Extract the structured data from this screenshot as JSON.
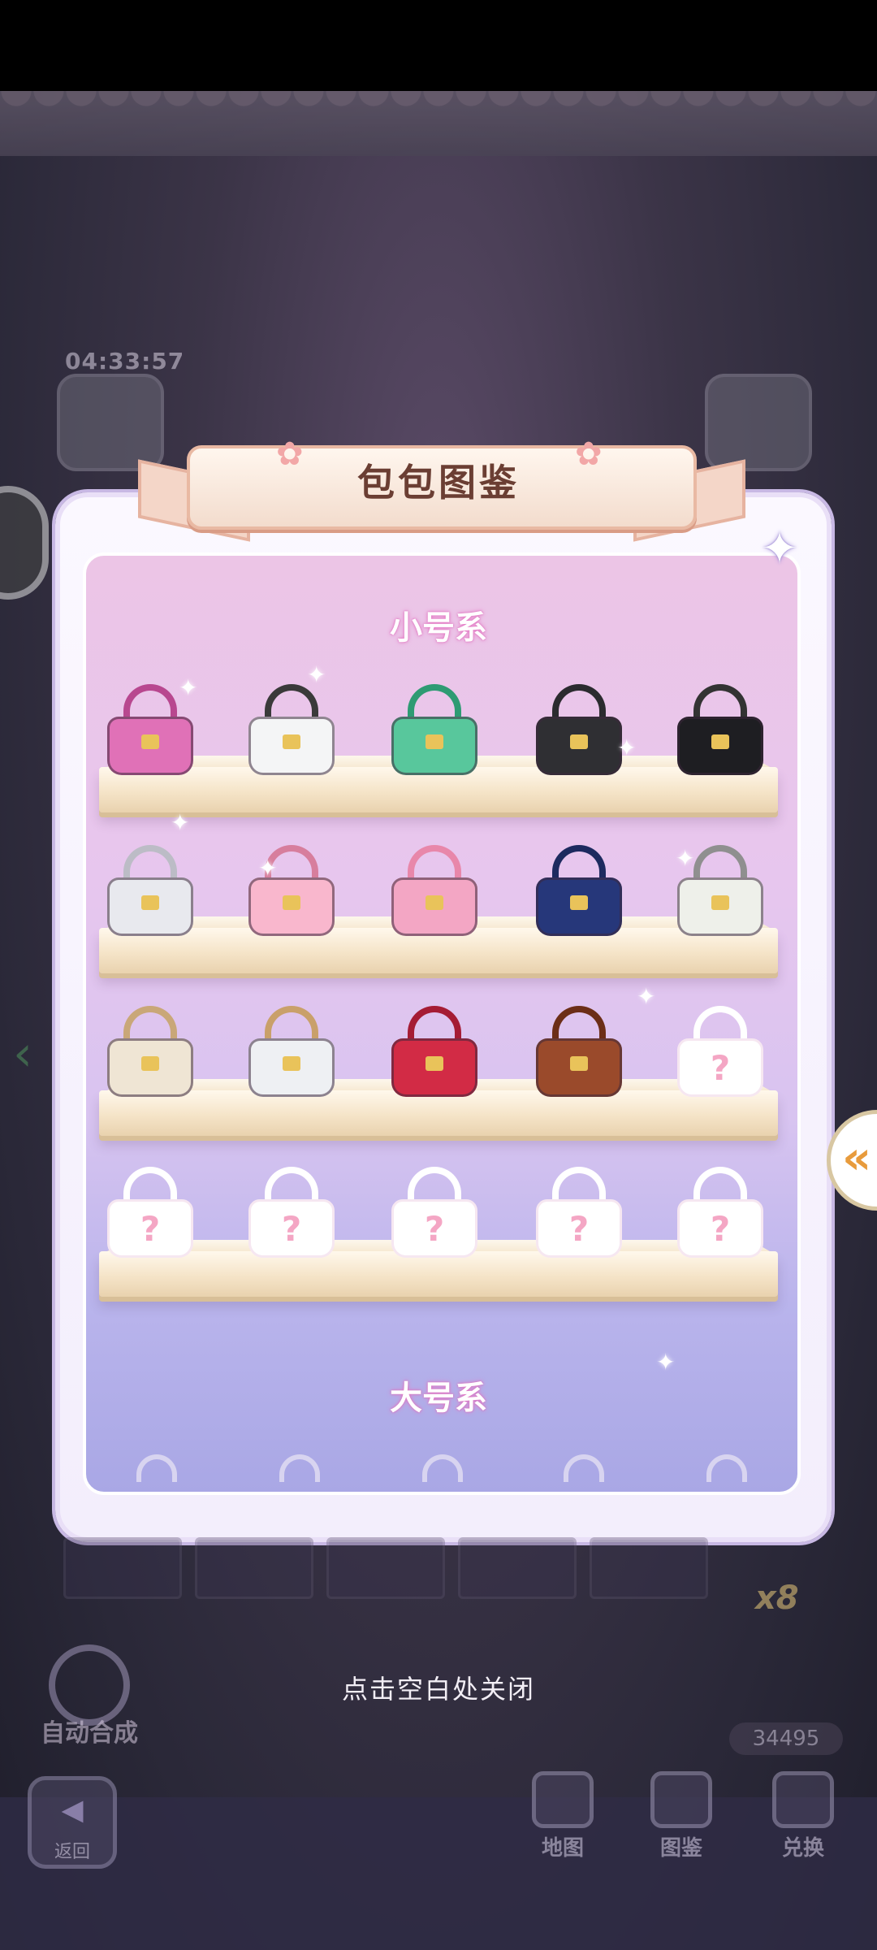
{
  "dialog": {
    "title": "包包图鉴",
    "close_icon": "close-star-icon",
    "section_small": "小号系",
    "section_large": "大号系",
    "locked_mark": "?",
    "hint": "点击空白处关闭"
  },
  "background": {
    "timer": "04:33:57",
    "multiplier": "x8",
    "coins": "34495",
    "auto_merge": "自动合成",
    "nav": {
      "back": "返回",
      "map": "地图",
      "catalog": "图鉴",
      "exchange": "兑换"
    }
  },
  "bag_rows": [
    [
      {
        "name": "pink-quilted-bag",
        "color": "#e071b7",
        "handle": "#b8478f",
        "locked": false
      },
      {
        "name": "white-flap-bag",
        "color": "#f4f5f6",
        "handle": "#3a3a3a",
        "locked": false
      },
      {
        "name": "mint-tote-bag",
        "color": "#58c79c",
        "handle": "#2e9b73",
        "locked": false
      },
      {
        "name": "black-argyle-bag",
        "color": "#2f2f33",
        "handle": "#2b2b2f",
        "locked": false
      },
      {
        "name": "black-fur-bag",
        "color": "#1e1e22",
        "handle": "#333",
        "locked": false
      }
    ],
    [
      {
        "name": "silver-structured-bag",
        "color": "#e8e9ee",
        "handle": "#bcbcc6",
        "locked": false
      },
      {
        "name": "pink-bow-bag",
        "color": "#f9b7cd",
        "handle": "#d77e9d",
        "locked": false
      },
      {
        "name": "pastel-colorblock-bag",
        "color": "#f3a6c4",
        "handle": "#e887aa",
        "locked": false
      },
      {
        "name": "navy-lock-bag",
        "color": "#26377a",
        "handle": "#1d2a5f",
        "locked": false
      },
      {
        "name": "floral-frame-bag",
        "color": "#eef0ea",
        "handle": "#8f8f8f",
        "locked": false
      }
    ],
    [
      {
        "name": "cream-chain-bag",
        "color": "#efe5d4",
        "handle": "#c9a778",
        "locked": false
      },
      {
        "name": "white-chain-bag",
        "color": "#eef0f3",
        "handle": "#c9a06a",
        "locked": false
      },
      {
        "name": "red-box-bag",
        "color": "#d22b45",
        "handle": "#a51c34",
        "locked": false
      },
      {
        "name": "brown-buckle-bag",
        "color": "#9a4a2b",
        "handle": "#6c2e17",
        "locked": false
      },
      {
        "name": "locked-bag",
        "locked": true
      }
    ],
    [
      {
        "name": "locked-bag",
        "locked": true
      },
      {
        "name": "locked-bag",
        "locked": true
      },
      {
        "name": "locked-bag",
        "locked": true
      },
      {
        "name": "locked-bag",
        "locked": true
      },
      {
        "name": "locked-bag",
        "locked": true
      }
    ]
  ]
}
